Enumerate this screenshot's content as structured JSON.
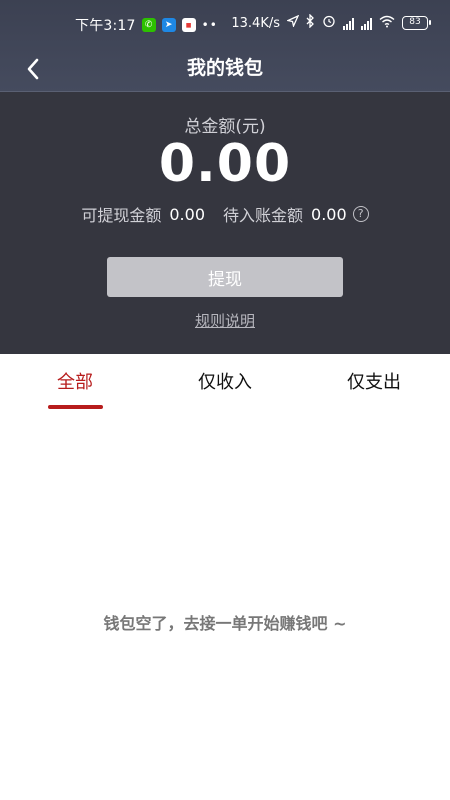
{
  "status_bar": {
    "time": "下午3:17",
    "network_speed": "13.4K/s",
    "battery": "83",
    "icons": [
      "wechat-icon",
      "app-icon",
      "news-app-icon",
      "location-icon",
      "bluetooth-icon",
      "alarm-icon",
      "signal-icon",
      "wifi-icon",
      "battery-icon"
    ]
  },
  "nav": {
    "title": "我的钱包",
    "back_icon": "chevron-left-icon"
  },
  "wallet": {
    "total_label": "总金额(元)",
    "total_amount": "0.00",
    "withdrawable_label": "可提现金额",
    "withdrawable_value": "0.00",
    "pending_label": "待入账金额",
    "pending_value": "0.00",
    "help_icon": "question-circle-icon",
    "withdraw_button": "提现",
    "rules_link": "规则说明"
  },
  "tabs": [
    {
      "label": "全部",
      "active": true
    },
    {
      "label": "仅收入",
      "active": false
    },
    {
      "label": "仅支出",
      "active": false
    }
  ],
  "empty_message": "钱包空了，去接一单开始赚钱吧 ~",
  "colors": {
    "header_bg": "#3c4152",
    "panel_bg": "#35363f",
    "accent": "#b71c1c",
    "button_bg": "#c3c3c8"
  }
}
